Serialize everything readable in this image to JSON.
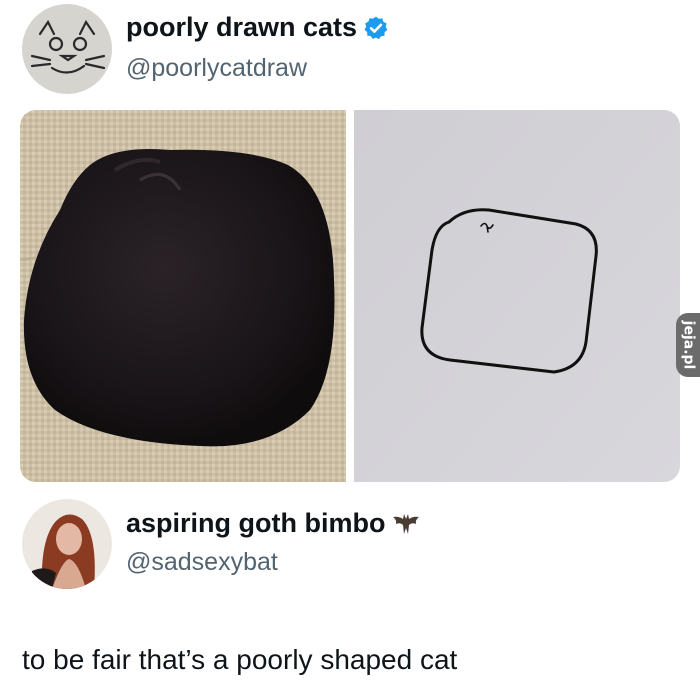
{
  "original_post": {
    "author_name": "poorly drawn cats",
    "author_handle": "@poorlycatdraw",
    "verified": true,
    "avatar_icon": "drawn-cat-face-icon",
    "media": [
      {
        "icon": "black-cat-photo"
      },
      {
        "icon": "square-cat-drawing"
      }
    ]
  },
  "reply": {
    "author_name": "aspiring goth bimbo",
    "author_handle": "@sadsexybat",
    "name_emoji_icon": "bat-icon",
    "text": "to be fair that’s a poorly shaped cat"
  },
  "watermark": {
    "text": "jeja.pl"
  },
  "colors": {
    "verified_badge": "#1d9bf0",
    "handle": "#536471",
    "text": "#0f1419"
  }
}
